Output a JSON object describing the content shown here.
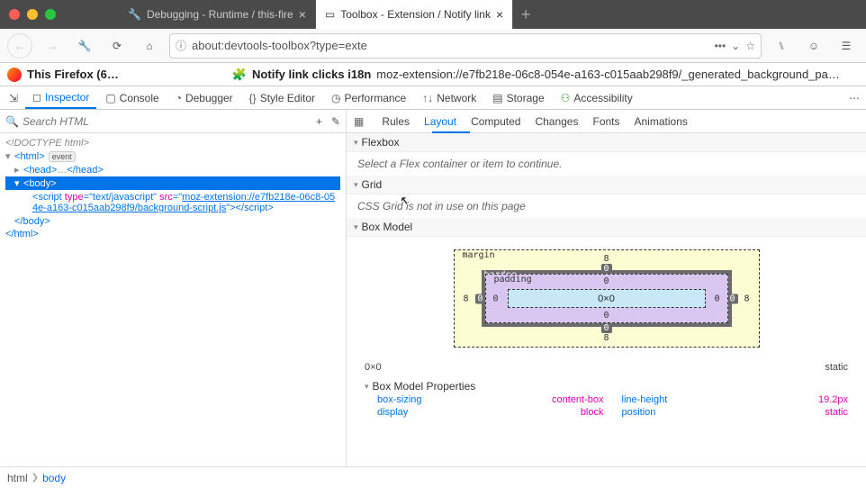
{
  "tabs": {
    "tab1": "Debugging - Runtime / this-fire",
    "tab2": "Toolbox - Extension / Notify link"
  },
  "url": "about:devtools-toolbox?type=exte",
  "context": {
    "left_label": "This Firefox (6…",
    "title": "Notify link clicks i18n",
    "path": "moz-extension://e7fb218e-06c8-054e-a163-c015aab298f9/_generated_background_pa…"
  },
  "devtools": {
    "inspector": "Inspector",
    "console": "Console",
    "debugger": "Debugger",
    "style_editor": "Style Editor",
    "performance": "Performance",
    "network": "Network",
    "storage": "Storage",
    "accessibility": "Accessibility"
  },
  "search_placeholder": "Search HTML",
  "panel_tabs": {
    "rules": "Rules",
    "layout": "Layout",
    "computed": "Computed",
    "changes": "Changes",
    "fonts": "Fonts",
    "animations": "Animations"
  },
  "markup": {
    "doctype": "<!DOCTYPE html>",
    "html_open": "html",
    "event": "event",
    "head_open": "head",
    "head_dots": "…",
    "head_close": "head",
    "body_open": "body",
    "script_tag": "script",
    "script_type_attr": "type",
    "script_type_val": "text/javascript",
    "script_src_attr": "src",
    "script_src_val": "moz-extension://e7fb218e-06c8-054e-a163-c015aab298f9/background-script.js",
    "body_close": "body",
    "html_close": "html"
  },
  "layout": {
    "flexbox_header": "Flexbox",
    "flexbox_body": "Select a Flex container or item to continue.",
    "grid_header": "Grid",
    "grid_body": "CSS Grid is not in use on this page",
    "boxmodel_header": "Box Model",
    "boxmodel": {
      "margin_label": "margin",
      "border_label": "border",
      "padding_label": "padding",
      "margin_top": "8",
      "margin_right": "8",
      "margin_bottom": "8",
      "margin_left": "8",
      "border_top": "0",
      "border_right": "0",
      "border_bottom": "0",
      "border_left": "0",
      "padding_top": "0",
      "padding_right": "0",
      "padding_bottom": "0",
      "padding_left": "0",
      "content": "0×0"
    },
    "dims_size": "0×0",
    "dims_pos": "static",
    "props_header": "Box Model Properties",
    "props": {
      "box_sizing_k": "box-sizing",
      "box_sizing_v": "content-box",
      "display_k": "display",
      "display_v": "block",
      "line_height_k": "line-height",
      "line_height_v": "19.2px",
      "position_k": "position",
      "position_v": "static"
    }
  },
  "breadcrumb": {
    "html": "html",
    "body": "body"
  }
}
